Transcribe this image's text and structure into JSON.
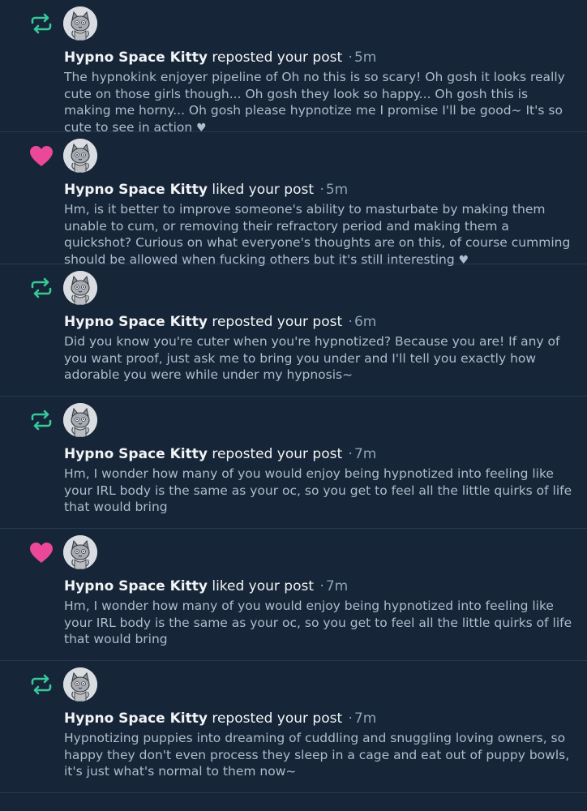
{
  "colors": {
    "background": "#162537",
    "repost_icon": "#37c99a",
    "like_icon": "#ec4899",
    "username": "#f1f3f5",
    "muted": "#8fa3bb",
    "body_text": "#aebdcd"
  },
  "notifications": [
    {
      "type": "repost",
      "icon": "repost-icon",
      "author": "Hypno Space Kitty",
      "action": "reposted your post",
      "separator": "·",
      "time": "5m",
      "text": "The hypnokink enjoyer pipeline of Oh no this is so scary! Oh gosh it looks really cute on those girls though... Oh gosh they look so happy... Oh gosh this is making me horny... Oh gosh please hypnotize me I promise I'll be good~ It's so cute to see in action",
      "trailing_heart": "♥"
    },
    {
      "type": "like",
      "icon": "heart-icon",
      "author": "Hypno Space Kitty",
      "action": "liked your post",
      "separator": "·",
      "time": "5m",
      "text": "Hm, is it better to improve someone's ability to masturbate by making them unable to cum, or removing their refractory period and making them a quickshot? Curious on what everyone's thoughts are on this, of course cumming should be allowed when fucking others but it's still interesting",
      "trailing_heart": "♥"
    },
    {
      "type": "repost",
      "icon": "repost-icon",
      "author": "Hypno Space Kitty",
      "action": "reposted your post",
      "separator": "·",
      "time": "6m",
      "text": "Did you know you're cuter when you're hypnotized? Because you are! If any of you want proof, just ask me to bring you under and I'll tell you exactly how adorable you were while under my hypnosis~",
      "trailing_heart": ""
    },
    {
      "type": "repost",
      "icon": "repost-icon",
      "author": "Hypno Space Kitty",
      "action": "reposted your post",
      "separator": "·",
      "time": "7m",
      "text": "Hm, I wonder how many of you would enjoy being hypnotized into feeling like your IRL body is the same as your oc, so you get to feel all the little quirks of life that would bring",
      "trailing_heart": ""
    },
    {
      "type": "like",
      "icon": "heart-icon",
      "author": "Hypno Space Kitty",
      "action": "liked your post",
      "separator": "·",
      "time": "7m",
      "text": "Hm, I wonder how many of you would enjoy being hypnotized into feeling like your IRL body is the same as your oc, so you get to feel all the little quirks of life that would bring",
      "trailing_heart": ""
    },
    {
      "type": "repost",
      "icon": "repost-icon",
      "author": "Hypno Space Kitty",
      "action": "reposted your post",
      "separator": "·",
      "time": "7m",
      "text": "Hypnotizing puppies into dreaming of cuddling and snuggling loving owners, so happy they don't even process they sleep in a cage and eat out of puppy bowls, it's just what's normal to them now~",
      "trailing_heart": ""
    }
  ]
}
